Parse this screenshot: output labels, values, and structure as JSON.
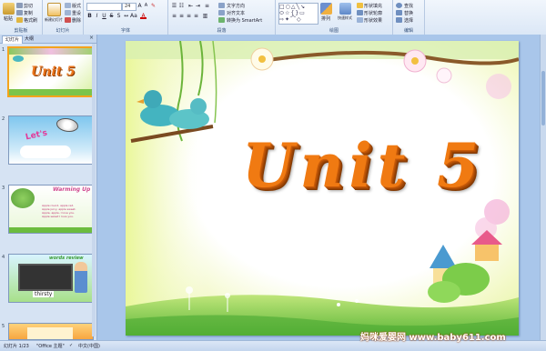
{
  "ribbon": {
    "clipboard": {
      "paste": "粘贴",
      "cut": "剪切",
      "copy": "复制",
      "format_painter": "格式刷",
      "group_label": "剪贴板"
    },
    "slides": {
      "new_slide": "新建幻灯片",
      "layout": "版式",
      "reset": "重设",
      "delete": "删除",
      "group_label": "幻灯片"
    },
    "font": {
      "font_size": "24",
      "group_label": "字体"
    },
    "paragraph": {
      "text_direction": "文字方向",
      "align_text": "对齐文本",
      "convert_smartart": "转换为 SmartArt",
      "group_label": "段落"
    },
    "drawing": {
      "arrange": "排列",
      "quick_styles": "快速样式",
      "shape_fill": "形状填充",
      "shape_outline": "形状轮廓",
      "shape_effects": "形状效果",
      "group_label": "绘图"
    },
    "editing": {
      "find": "查找",
      "replace": "替换",
      "select": "选择",
      "group_label": "编辑"
    }
  },
  "panel": {
    "tab_slides": "幻灯片",
    "tab_outline": "大纲",
    "thumbnails": [
      {
        "number": "1",
        "title": "Unit 5"
      },
      {
        "number": "2",
        "title": "Let's"
      },
      {
        "number": "3",
        "title": "Warming Up",
        "song": "Apple round, apple red. Apple juicy, apple sweet. Apple, apple, I love you. Apple sweet I love you."
      },
      {
        "number": "4",
        "title": "words review",
        "word": "thirsty"
      },
      {
        "number": "5",
        "title": ""
      }
    ]
  },
  "slide": {
    "title": "Unit 5"
  },
  "status": {
    "slide_counter": "幻灯片 1/23",
    "theme": "\"Office 主题\"",
    "language": "中文(中国)"
  },
  "watermark": "妈咪爱婴网 www.baby611.com",
  "colors": {
    "ribbon_bg": "#dbe7f6",
    "workarea_bg": "#a9c6ea",
    "title_orange": "#f07a12",
    "selected_border": "#f4a31c"
  }
}
